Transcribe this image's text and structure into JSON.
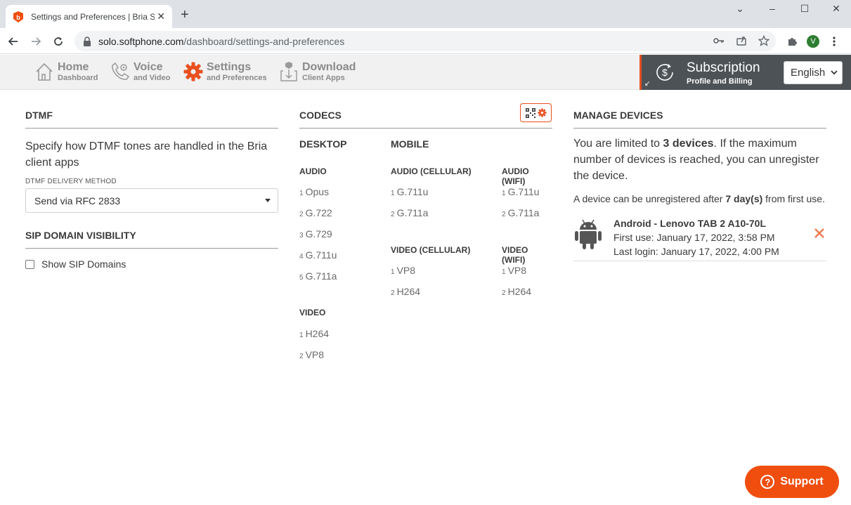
{
  "browser": {
    "tab_title": "Settings and Preferences | Bria Solo",
    "url_host": "solo.softphone.com",
    "url_path": "/dashboard/settings-and-preferences",
    "profile_initial": "V"
  },
  "nav": {
    "home": {
      "label": "Home",
      "sub": "Dashboard"
    },
    "voice": {
      "label": "Voice",
      "sub": "and Video"
    },
    "settings": {
      "label": "Settings",
      "sub": "and Preferences"
    },
    "download": {
      "label": "Download",
      "sub": "Client Apps"
    },
    "subscription": {
      "label": "Subscription",
      "sub": "Profile and Billing"
    },
    "language": "English"
  },
  "dtmf": {
    "title": "DTMF",
    "description": "Specify how DTMF tones are handled in the Bria client apps",
    "field_label": "DTMF DELIVERY METHOD",
    "selected": "Send via RFC 2833"
  },
  "sip": {
    "title": "SIP DOMAIN VISIBILITY",
    "checkbox_label": "Show SIP Domains"
  },
  "codecs": {
    "title": "CODECS",
    "desktop": {
      "title": "DESKTOP",
      "audio_title": "AUDIO",
      "audio": [
        {
          "idx": "1",
          "name": "Opus"
        },
        {
          "idx": "2",
          "name": "G.722"
        },
        {
          "idx": "3",
          "name": "G.729"
        },
        {
          "idx": "4",
          "name": "G.711u"
        },
        {
          "idx": "5",
          "name": "G.711a"
        }
      ],
      "video_title": "VIDEO",
      "video": [
        {
          "idx": "1",
          "name": "H264"
        },
        {
          "idx": "2",
          "name": "VP8"
        }
      ]
    },
    "mobile": {
      "title": "MOBILE",
      "audio_cellular_title": "AUDIO (CELLULAR)",
      "audio_cellular": [
        {
          "idx": "1",
          "name": "G.711u"
        },
        {
          "idx": "2",
          "name": "G.711a"
        }
      ],
      "audio_wifi_title": "AUDIO (WIFI)",
      "audio_wifi": [
        {
          "idx": "1",
          "name": "G.711u"
        },
        {
          "idx": "2",
          "name": "G.711a"
        }
      ],
      "video_cellular_title": "VIDEO (CELLULAR)",
      "video_cellular": [
        {
          "idx": "1",
          "name": "VP8"
        },
        {
          "idx": "2",
          "name": "H264"
        }
      ],
      "video_wifi_title": "VIDEO (WIFI)",
      "video_wifi": [
        {
          "idx": "1",
          "name": "VP8"
        },
        {
          "idx": "2",
          "name": "H264"
        }
      ]
    }
  },
  "devices": {
    "title": "MANAGE DEVICES",
    "limit_prefix": "You are limited to ",
    "limit_value": "3 devices",
    "limit_suffix": ". If the maximum number of devices is reached, you can unregister the device.",
    "note_prefix": "A device can be unregistered after ",
    "note_value": "7 day(s)",
    "note_suffix": " from first use.",
    "items": [
      {
        "name": "Android - Lenovo TAB 2 A10-70L",
        "first_use": "First use: January 17, 2022, 3:58 PM",
        "last_login": "Last login: January 17, 2022, 4:00 PM"
      }
    ]
  },
  "support_label": "Support",
  "colors": {
    "accent": "#e8501f",
    "support": "#f04e0f",
    "subscription_bg": "#4d5256"
  }
}
